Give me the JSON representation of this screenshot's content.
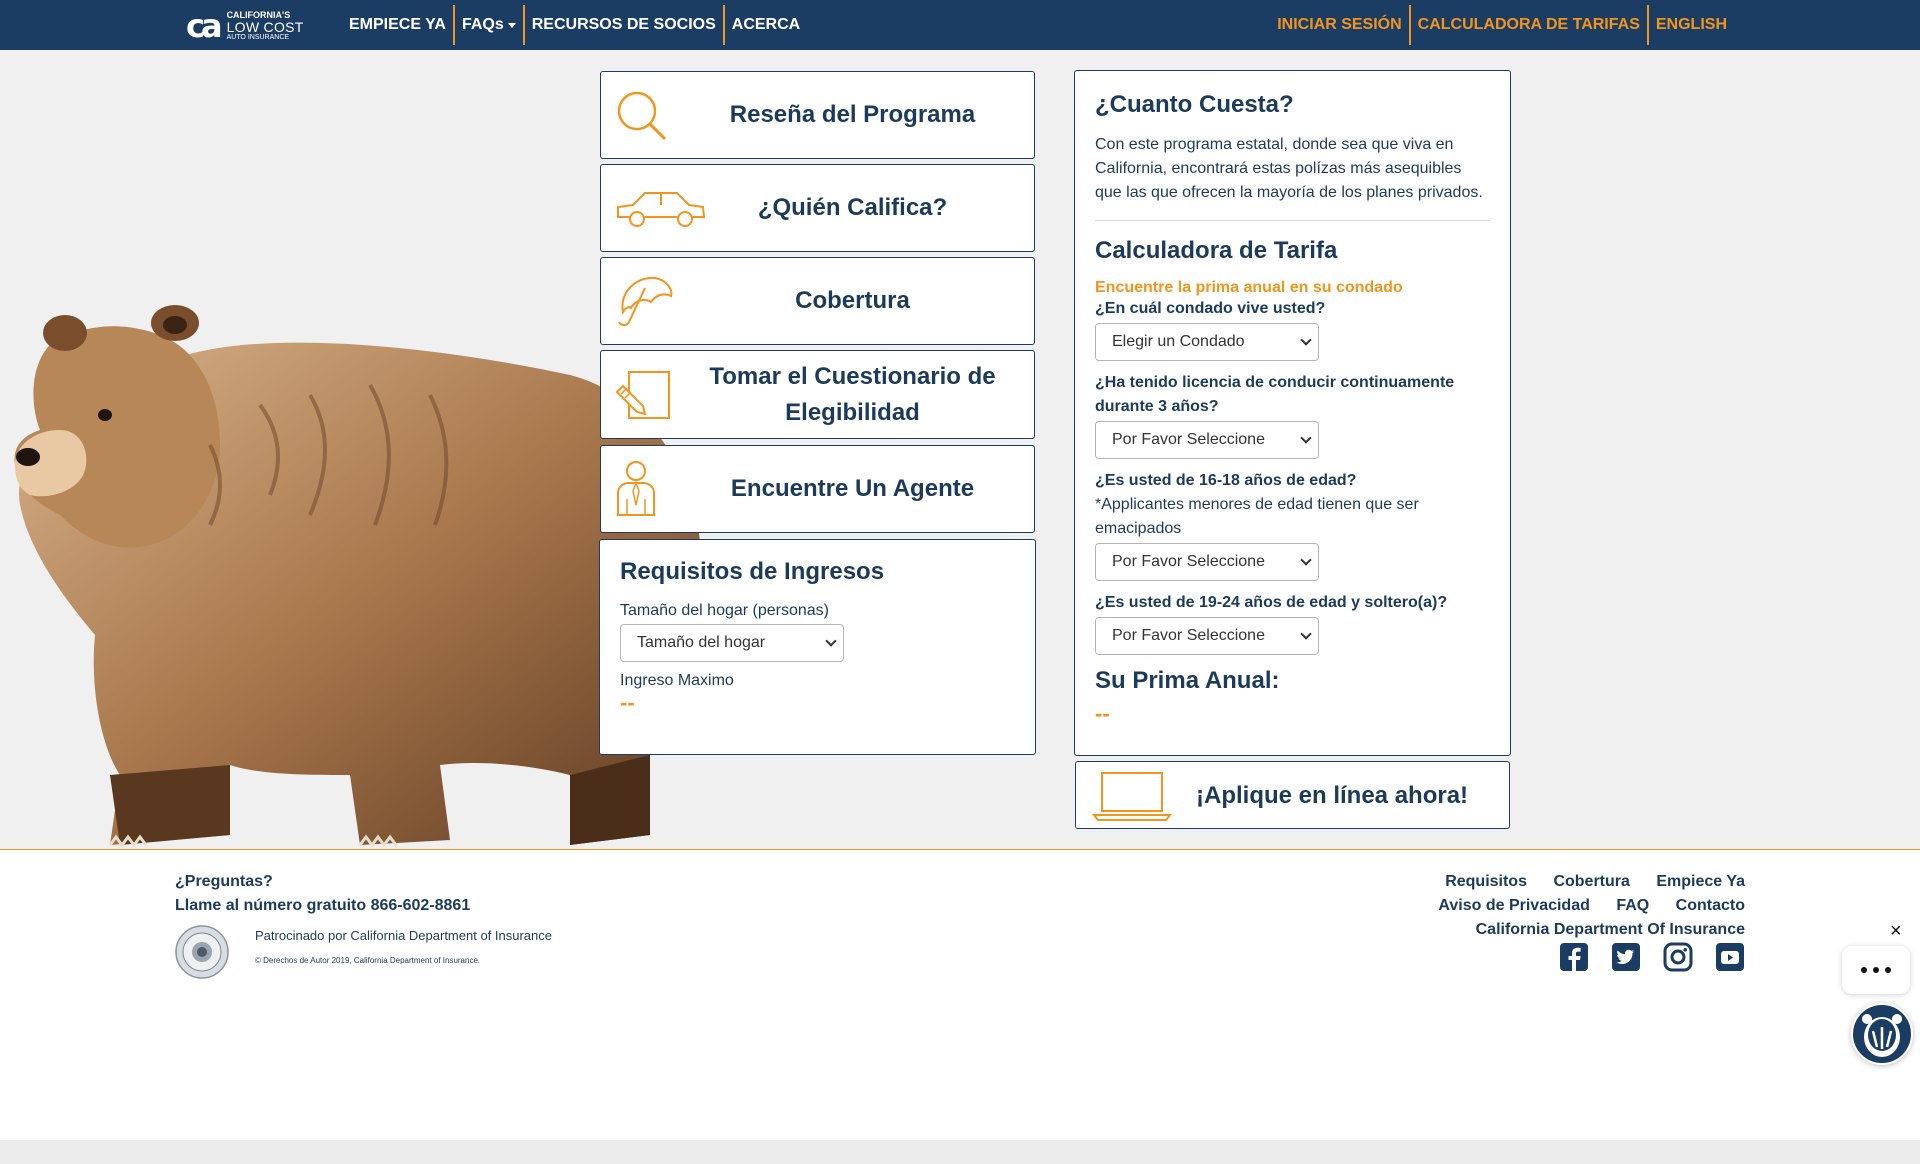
{
  "colors": {
    "navy": "#1c3d63",
    "orange": "#f3941e",
    "background": "#f0f0f0"
  },
  "logo": {
    "line1": "CALIFORNIA'S",
    "line2": "LOW COST",
    "line3": "AUTO INSURANCE",
    "mark": "ca"
  },
  "nav": {
    "left": [
      "EMPIECE YA",
      "FAQs",
      "RECURSOS DE SOCIOS",
      "ACERCA"
    ],
    "right": [
      "INICIAR SESIÓN",
      "CALCULADORA DE TARIFAS",
      "ENGLISH"
    ]
  },
  "cards": [
    {
      "title": "Reseña del Programa",
      "icon": "magnifier-icon"
    },
    {
      "title": "¿Quién Califica?",
      "icon": "car-icon"
    },
    {
      "title": "Cobertura",
      "icon": "umbrella-icon"
    },
    {
      "title": "Tomar el Cuestionario de Elegibilidad",
      "icon": "pencil-paper-icon"
    },
    {
      "title": "Encuentre Un Agente",
      "icon": "agent-icon"
    }
  ],
  "income": {
    "title": "Requisitos de Ingresos",
    "household_label": "Tamaño del hogar (personas)",
    "household_select": "Tamaño del hogar",
    "max_label": "Ingreso Maximo",
    "max_value": "--"
  },
  "cost": {
    "title": "¿Cuanto Cuesta?",
    "text": "Con este programa estatal, donde sea que viva en California, encontrará estas polízas más asequibles que las que ofrecen la mayoría de los planes privados."
  },
  "calculator": {
    "title": "Calculadora de Tarifa",
    "subtitle": "Encuentre la prima anual en su condado",
    "q1": "¿En cuál condado vive usted?",
    "q1_select": "Elegir un Condado",
    "q2": "¿Ha tenido licencia de conducir continuamente durante 3 años?",
    "q2_select": "Por Favor Seleccione",
    "q3": "¿Es usted de 16-18 años de edad?",
    "q3_note": "*Applicantes menores de edad tienen que ser emacipados",
    "q3_select": "Por Favor Seleccione",
    "q4": "¿Es usted de 19-24 años de edad y soltero(a)?",
    "q4_select": "Por Favor Seleccione",
    "premium_label": "Su Prima Anual:",
    "premium_value": "--"
  },
  "apply": {
    "title": "¡Aplique en línea ahora!"
  },
  "footer": {
    "questions": "¿Preguntas?",
    "phone": "Llame al número gratuito 866-602-8861",
    "sponsor": "Patrocinado por California Department of Insurance",
    "copyright": "© Derechos de Autor 2019, California Department of Insurance.",
    "links_row1": [
      "Requisitos",
      "Cobertura",
      "Empiece Ya"
    ],
    "links_row2": [
      "Aviso de Privacidad",
      "FAQ",
      "Contacto"
    ],
    "links_row3": [
      "California Department Of Insurance"
    ],
    "social": [
      "facebook-icon",
      "twitter-icon",
      "instagram-icon",
      "youtube-icon"
    ]
  },
  "chat": {
    "close": "×"
  }
}
